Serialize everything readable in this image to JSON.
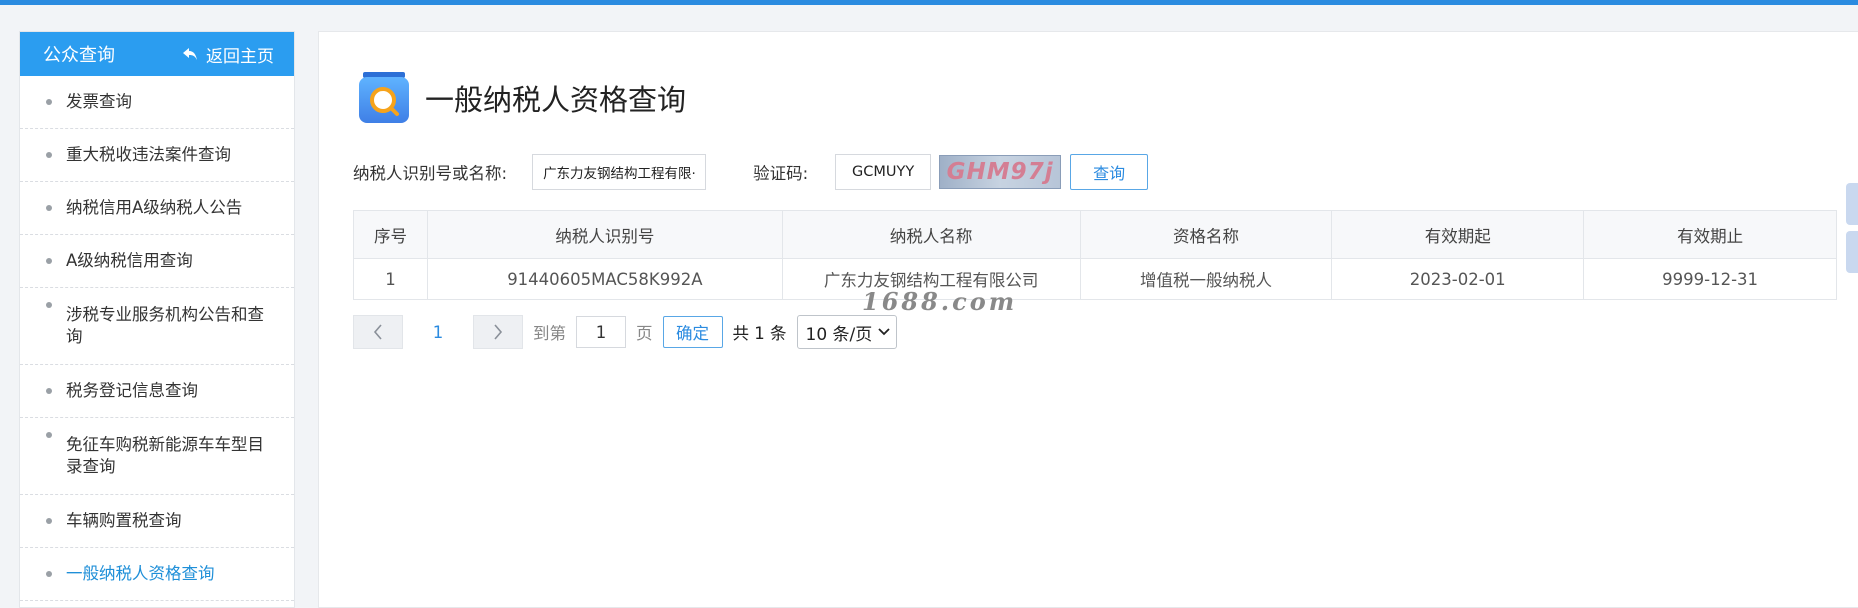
{
  "sidebar": {
    "title": "公众查询",
    "back_label": "返回主页",
    "items": [
      {
        "label": "发票查询"
      },
      {
        "label": "重大税收违法案件查询"
      },
      {
        "label": "纳税信用A级纳税人公告"
      },
      {
        "label": "A级纳税信用查询"
      },
      {
        "label": "涉税专业服务机构公告和查询"
      },
      {
        "label": "税务登记信息查询"
      },
      {
        "label": "免征车购税新能源车车型目录查询"
      },
      {
        "label": "车辆购置税查询"
      },
      {
        "label": "一般纳税人资格查询"
      }
    ]
  },
  "main": {
    "title": "一般纳税人资格查询",
    "form": {
      "taxpayer_label": "纳税人识别号或名称:",
      "taxpayer_value": "广东力友钢结构工程有限·",
      "captcha_label": "验证码:",
      "captcha_value": "GCMUYY",
      "captcha_image_text": "GHM97j",
      "query_label": "查询"
    },
    "table": {
      "headers": [
        "序号",
        "纳税人识别号",
        "纳税人名称",
        "资格名称",
        "有效期起",
        "有效期止"
      ],
      "rows": [
        [
          "1",
          "91440605MAC58K992A",
          "广东力友钢结构工程有限公司",
          "增值税一般纳税人",
          "2023-02-01",
          "9999-12-31"
        ]
      ]
    },
    "pagination": {
      "current_page": "1",
      "goto_label": "到第",
      "goto_value": "1",
      "page_suffix": "页",
      "confirm_label": "确定",
      "total_text": "共 1 条",
      "page_size": "10 条/页"
    }
  },
  "watermark": "1688.com",
  "colors": {
    "accent": "#2b9df0",
    "active_link": "#1f8fd8",
    "top_bar": "#2b8be0"
  },
  "icons": [
    "back-arrow-icon",
    "search-document-icon",
    "chevron-left-icon",
    "chevron-right-icon",
    "chevron-down-icon"
  ]
}
